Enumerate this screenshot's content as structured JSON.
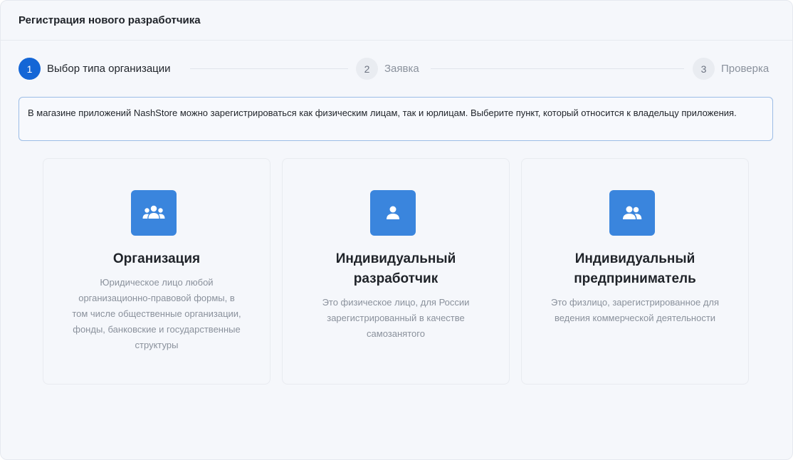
{
  "header": {
    "title": "Регистрация нового разработчика"
  },
  "steps": [
    {
      "number": "1",
      "label": "Выбор типа организации",
      "state": "active"
    },
    {
      "number": "2",
      "label": "Заявка",
      "state": "inactive"
    },
    {
      "number": "3",
      "label": "Проверка",
      "state": "inactive"
    }
  ],
  "info": {
    "text": "В магазине приложений NashStore можно зарегистрироваться как физическим лицам, так и юрлицам. Выберите пункт, который относится к владельцу приложения."
  },
  "cards": [
    {
      "icon": "group-icon",
      "title": "Организация",
      "description": "Юридическое лицо любой организационно-правовой формы, в том числе общественные организации, фонды, банковские и государственные структуры"
    },
    {
      "icon": "user-icon",
      "title": "Индивидуальный разработчик",
      "description": "Это физическое лицо, для России зарегистрированный в качестве самозанятого"
    },
    {
      "icon": "users-icon",
      "title": "Индивидуальный предприниматель",
      "description": "Это физлицо, зарегистрированное для ведения коммерческой деятельности"
    }
  ],
  "colors": {
    "accent": "#1466d6",
    "icon_tile": "#3a85dd",
    "info_border": "#9cbde6",
    "background": "#f5f7fb"
  }
}
